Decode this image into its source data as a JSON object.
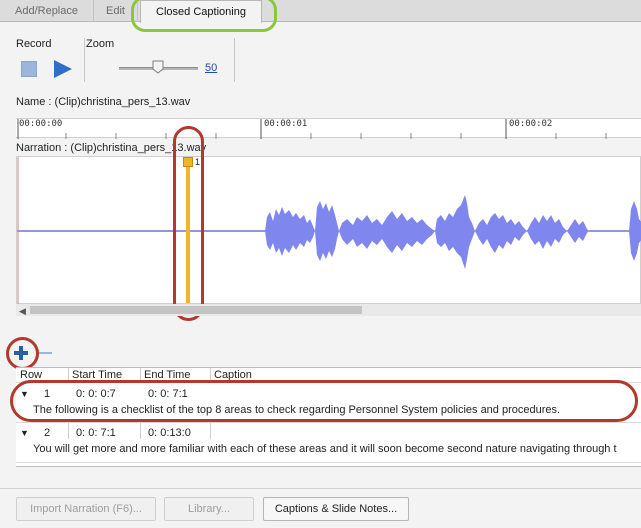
{
  "tabs": [
    {
      "label": "Add/Replace"
    },
    {
      "label": "Edit"
    },
    {
      "label": "Closed Captioning"
    }
  ],
  "record": {
    "label": "Record"
  },
  "zoom": {
    "label": "Zoom",
    "value": "50",
    "slider_fraction": 0.45
  },
  "clip": {
    "name_label": "Name :",
    "name_value": "(Clip)christina_pers_13.wav"
  },
  "ruler": {
    "ticks": [
      "00:00:00",
      "00:00:01",
      "00:00:02"
    ]
  },
  "waveform": {
    "header": "Narration : (Clip)christina_pers_13.wav",
    "marker_number": "1",
    "colors": {
      "wave": "#7f86ee",
      "marker": "#f2b429",
      "baseline": "#2b2bb3"
    }
  },
  "caption_toolbar": {
    "add_icon": "plus-icon",
    "remove_icon": "minus-icon"
  },
  "table": {
    "headers": [
      "Row",
      "Start Time",
      "End Time",
      "Caption"
    ],
    "rows": [
      {
        "row": "1",
        "start": "0: 0: 0:7",
        "end": "0: 0: 7:1",
        "caption": "The following is a checklist of the top 8 areas to check regarding Personnel System policies and procedures."
      },
      {
        "row": "2",
        "start": "0: 0: 7:1",
        "end": "0: 0:13:0",
        "caption": "You will get more and more familiar with each of these areas and it will soon become second nature navigating through t"
      }
    ]
  },
  "buttons": {
    "import": "Import Narration (F6)...",
    "library": "Library...",
    "captions": "Captions & Slide Notes..."
  }
}
